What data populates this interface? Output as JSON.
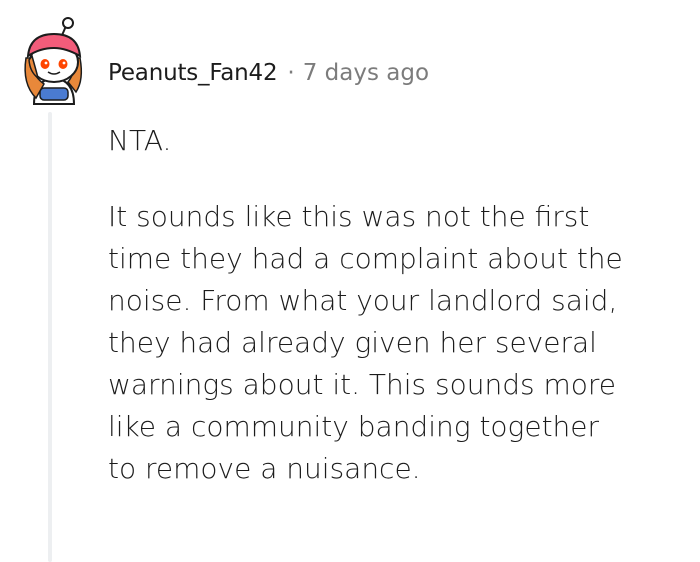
{
  "comment": {
    "author": "Peanuts_Fan42",
    "separator": "·",
    "timestamp": "7 days ago",
    "paragraphs": [
      "NTA.",
      "It sounds like this was not the first\ntime they had a complaint about the\nnoise. From what your landlord said,\nthey had already given her several\nwarnings about it. This sounds more\nlike a community banding together\nto remove a nuisance."
    ]
  },
  "avatar": {
    "icon": "snoo-avatar-icon",
    "colors": {
      "hat": "#f25c7a",
      "hair": "#e8883a",
      "face": "#ffffff",
      "eyes": "#ff4500",
      "shirt": "#4a7bd1"
    }
  },
  "colors": {
    "text": "#1c1c1c",
    "meta": "#7c7c7c",
    "thread_line": "#edeff1"
  }
}
